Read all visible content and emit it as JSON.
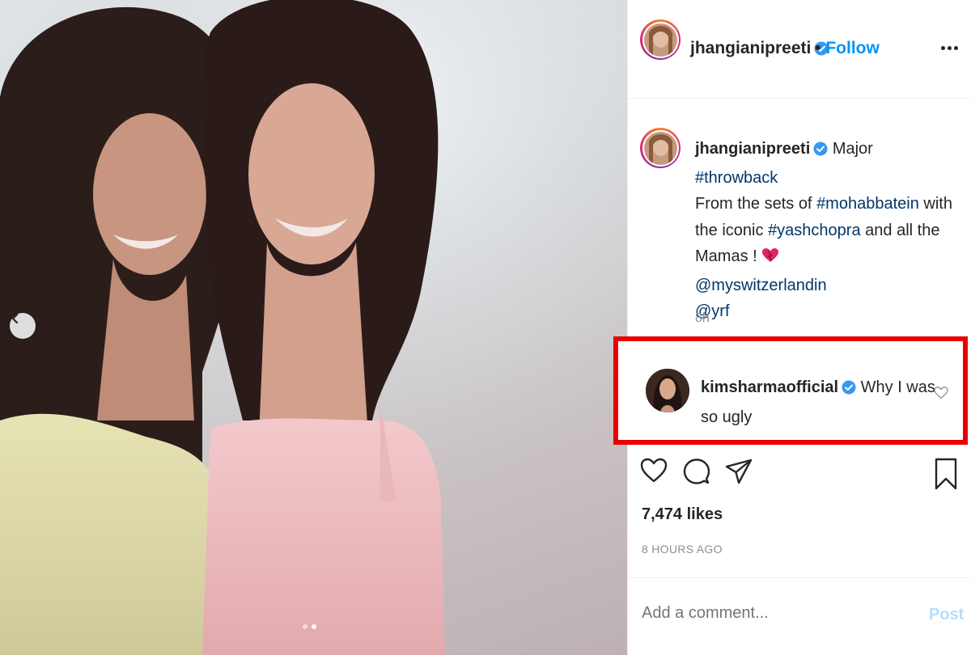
{
  "post": {
    "author": "jhangianipreeti",
    "follow_separator": "•",
    "follow_label": "Follow",
    "more_icon": "more-options-icon",
    "verified_color": "#3897f0",
    "follow_color": "#0095f6"
  },
  "caption": {
    "username": "jhangianipreeti",
    "parts": [
      {
        "text": "Major ",
        "type": "text"
      },
      {
        "text": "#throwback",
        "type": "tag"
      },
      {
        "text": "From the sets of ",
        "type": "text"
      },
      {
        "text": "#mohabbatein",
        "type": "tag"
      },
      {
        "text": " with the iconic ",
        "type": "text"
      },
      {
        "text": "#yashchopra",
        "type": "tag"
      },
      {
        "text": " and all the Mamas ! ",
        "type": "text"
      },
      {
        "text": "@myswitzerlandin",
        "type": "tag"
      },
      {
        "text": "@yrf",
        "type": "tag"
      }
    ],
    "emoji_icon": "red-heart-icon",
    "time": "8h"
  },
  "comment": {
    "username": "kimsharmaofficial",
    "text": "Why I was so ugly",
    "highlight_color": "#ea0000"
  },
  "actions": {
    "icons": [
      "heart-icon",
      "comment-icon",
      "share-icon",
      "bookmark-icon"
    ]
  },
  "likes": "7,474 likes",
  "timestamp": "8 HOURS AGO",
  "add_comment": {
    "placeholder": "Add a comment...",
    "post_label": "Post"
  },
  "carousel": {
    "total": 2,
    "active_index": 1,
    "prev_icon": "chevron-left-icon"
  }
}
